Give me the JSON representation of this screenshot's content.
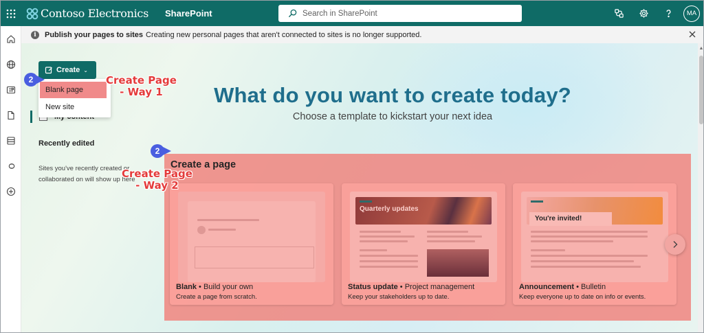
{
  "suitebar": {
    "brand": "Contoso Electronics",
    "app": "SharePoint",
    "search_placeholder": "Search in SharePoint",
    "avatar_initials": "MA",
    "accent": "#0f6b66"
  },
  "message_bar": {
    "bold": "Publish your pages to sites",
    "text": "Creating new personal pages that aren't connected to sites is no longer supported."
  },
  "create": {
    "label": "Create",
    "menu": [
      "Blank page",
      "New site"
    ]
  },
  "left_panel": {
    "my_content": "My content",
    "recently_edited": "Recently edited",
    "sites_note": "Sites you've recently created or collaborated on will show up here"
  },
  "hero": {
    "title": "What do you want to create today?",
    "subtitle": "Choose a template to kickstart your next idea"
  },
  "section": {
    "title": "Create a page",
    "cards": [
      {
        "name": "Blank",
        "tag": "Build your own",
        "desc": "Create a page from scratch.",
        "thumb_text": ""
      },
      {
        "name": "Status update",
        "tag": "Project management",
        "desc": "Keep your stakeholders up to date.",
        "thumb_text": "Quarterly updates"
      },
      {
        "name": "Announcement",
        "tag": "Bulletin",
        "desc": "Keep everyone up to date on info or events.",
        "thumb_text": "You're invited!"
      }
    ]
  },
  "annotations": {
    "badge_1": "2",
    "badge_2": "2",
    "way1_line1": "Create Page",
    "way1_line2": "- Way 1",
    "way2_line1": "Create Page",
    "way2_line2": "- Way 2"
  }
}
